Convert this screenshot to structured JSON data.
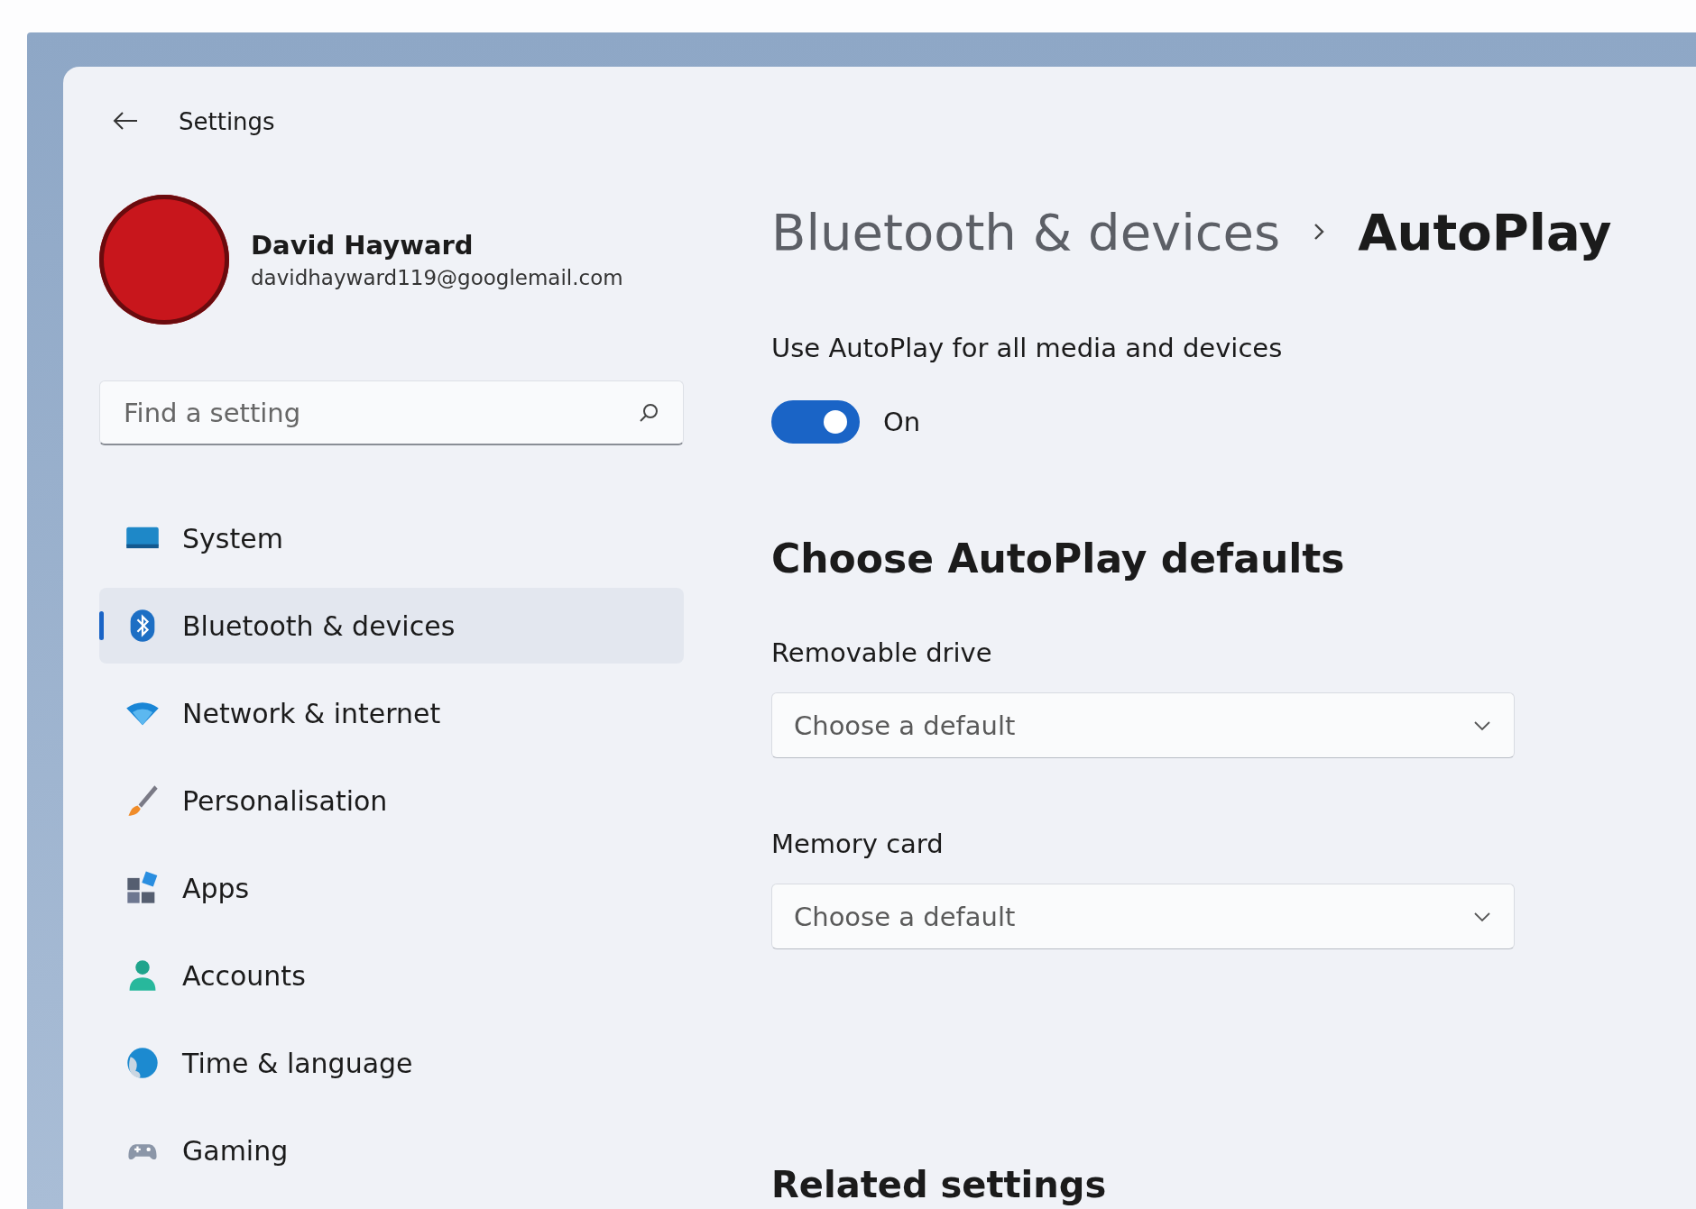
{
  "window": {
    "title": "Settings"
  },
  "profile": {
    "name": "David Hayward",
    "email": "davidhayward119@googlemail.com"
  },
  "search": {
    "placeholder": "Find a setting"
  },
  "nav": [
    {
      "label": "System",
      "kind": "system",
      "selected": false
    },
    {
      "label": "Bluetooth & devices",
      "kind": "bluetooth",
      "selected": true
    },
    {
      "label": "Network & internet",
      "kind": "network",
      "selected": false
    },
    {
      "label": "Personalisation",
      "kind": "personalisation",
      "selected": false
    },
    {
      "label": "Apps",
      "kind": "apps",
      "selected": false
    },
    {
      "label": "Accounts",
      "kind": "accounts",
      "selected": false
    },
    {
      "label": "Time & language",
      "kind": "time",
      "selected": false
    },
    {
      "label": "Gaming",
      "kind": "gaming",
      "selected": false
    }
  ],
  "breadcrumb": {
    "parent": "Bluetooth & devices",
    "current": "AutoPlay"
  },
  "autoplay": {
    "label": "Use AutoPlay for all media and devices",
    "on": true,
    "state_text": "On"
  },
  "section_title": "Choose AutoPlay defaults",
  "defaults": [
    {
      "label": "Removable drive",
      "placeholder": "Choose a default"
    },
    {
      "label": "Memory card",
      "placeholder": "Choose a default"
    }
  ],
  "related_title": "Related settings"
}
